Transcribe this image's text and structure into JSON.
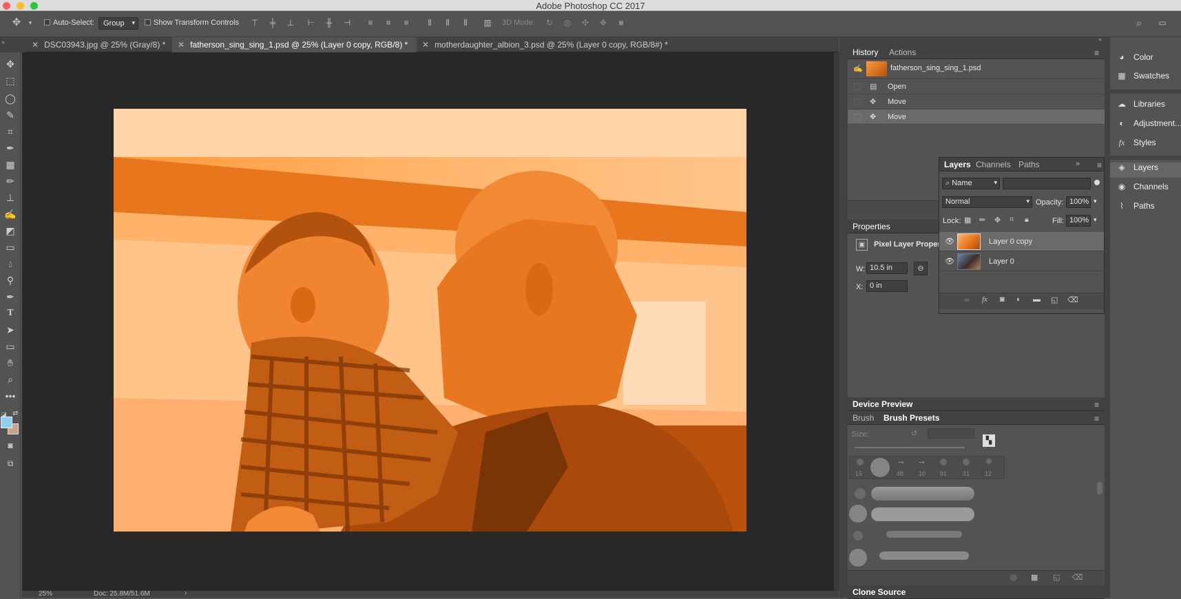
{
  "window": {
    "title": "Adobe Photoshop CC 2017"
  },
  "options_bar": {
    "auto_select_label": "Auto-Select:",
    "auto_select_value": "Group",
    "show_transform_label": "Show Transform Controls",
    "mode_3d_label": "3D Mode:"
  },
  "tabs": [
    {
      "label": "DSC03943.jpg @ 25% (Gray/8) *"
    },
    {
      "label": "fatherson_sing_sing_1.psd @ 25% (Layer 0 copy, RGB/8) *"
    },
    {
      "label": "motherdaughter_albion_3.psd @ 25% (Layer 0 copy, RGB/8#) *"
    }
  ],
  "status": {
    "zoom": "25%",
    "doc": "Doc: 25.8M/51.6M"
  },
  "history_panel": {
    "tabs": [
      "History",
      "Actions"
    ],
    "snapshot": "fatherson_sing_sing_1.psd",
    "items": [
      "Open",
      "Move",
      "Move"
    ]
  },
  "dock": {
    "group1": [
      "Color",
      "Swatches"
    ],
    "group2": [
      "Libraries",
      "Adjustment...",
      "Styles"
    ],
    "group3": [
      "Layers",
      "Channels",
      "Paths"
    ]
  },
  "layers_panel": {
    "tabs": [
      "Layers",
      "Channels",
      "Paths"
    ],
    "filter": "Name",
    "blend_mode": "Normal",
    "opacity_label": "Opacity:",
    "opacity": "100%",
    "lock_label": "Lock:",
    "fill_label": "Fill:",
    "fill": "100%",
    "layers": [
      "Layer 0 copy",
      "Layer 0"
    ]
  },
  "properties_panel": {
    "title": "Properties",
    "subtitle": "Pixel Layer Proper",
    "w_label": "W:",
    "w_value": "10.5 in",
    "x_label": "X:",
    "x_value": "0 in"
  },
  "device_preview": {
    "title": "Device Preview"
  },
  "brush_panel": {
    "tabs": [
      "Brush",
      "Brush Presets"
    ],
    "size_label": "Size:",
    "preset_sizes": [
      "15",
      "",
      "48",
      "10",
      "91",
      "31",
      "12"
    ]
  },
  "clone_source": {
    "title": "Clone Source"
  },
  "colors": {
    "accent": "#ff8c1a",
    "fg_swatch": "#8fd0f0",
    "bg_swatch": "#c9a48a"
  }
}
